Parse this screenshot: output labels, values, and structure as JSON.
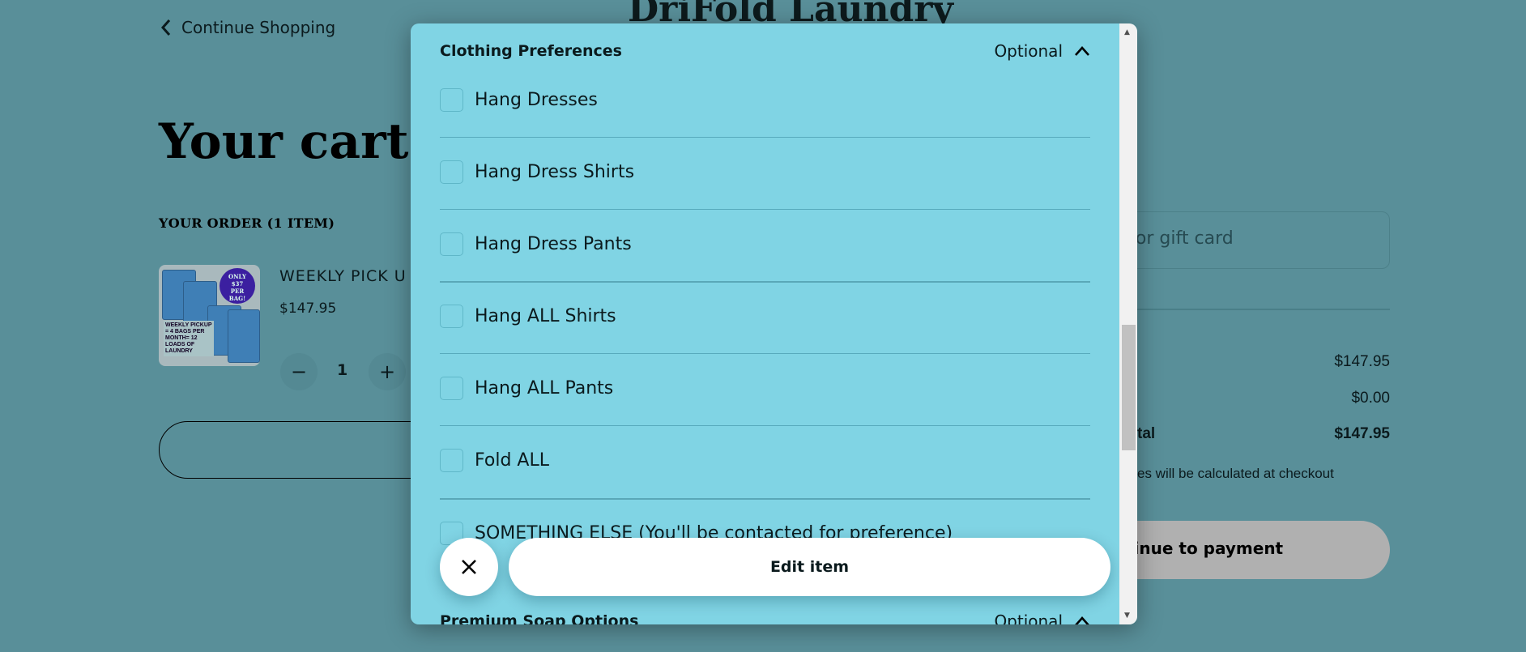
{
  "header": {
    "brand": "DriFold Laundry",
    "back_label": "Continue Shopping"
  },
  "cart": {
    "title": "Your cart",
    "order_heading": "YOUR ORDER (1 ITEM)",
    "item": {
      "name": "WEEKLY PICK U",
      "price": "$147.95",
      "quantity": "1",
      "image_badge": "ONLY $37 PER BAG!",
      "image_text": "WEEKLY PICKUP = 4 BAGS PER MONTH= 12 LOADS OF LAUNDRY"
    }
  },
  "summary": {
    "discount_placeholder": "n or gift card",
    "subtotal": "$147.95",
    "shipping": "$0.00",
    "total_label": "tal",
    "total": "$147.95",
    "tax_note": "es will be calculated at checkout",
    "pay_label": "tinue to payment"
  },
  "modal": {
    "section1": {
      "title": "Clothing Preferences",
      "badge": "Optional"
    },
    "options": [
      {
        "label": "Hang Dresses",
        "checked": false
      },
      {
        "label": "Hang Dress Shirts",
        "checked": false
      },
      {
        "label": "Hang Dress Pants",
        "checked": false
      },
      {
        "label": "Hang ALL Shirts",
        "checked": false
      },
      {
        "label": "Hang ALL Pants",
        "checked": false
      },
      {
        "label": "Fold ALL",
        "checked": false
      },
      {
        "label": "SOMETHING ELSE (You'll be contacted for preference)",
        "checked": false
      }
    ],
    "section2": {
      "title": "Premium Soap Options",
      "badge": "Optional"
    },
    "edit_label": "Edit item"
  },
  "colors": {
    "overlay_bg": "#598f99",
    "modal_bg": "#80d4e4",
    "pay_button": "#b0b0b0"
  }
}
